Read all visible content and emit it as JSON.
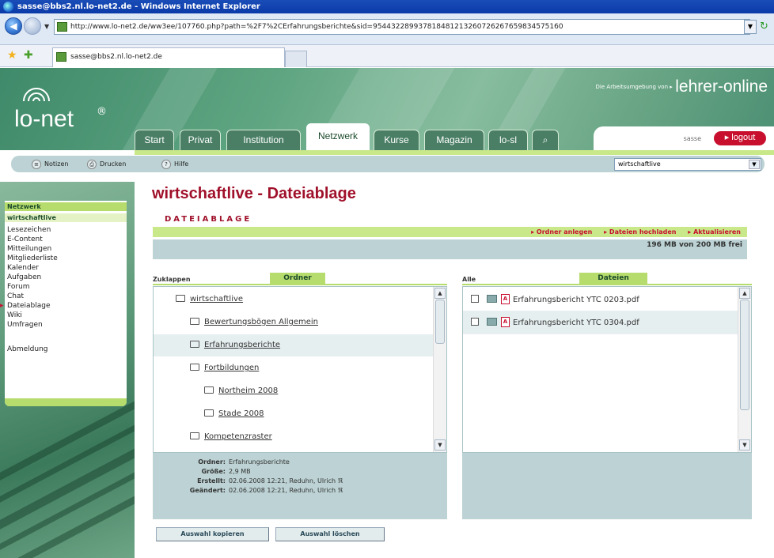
{
  "browser": {
    "title": "sasse@bbs2.nl.lo-net2.de - Windows Internet Explorer",
    "url": "http://www.lo-net2.de/ww3ee/107760.php?path=%2F7%2CErfahrungsberichte&sid=95443228993781848121326072626765983457516​0",
    "tab_title": "sasse@bbs2.nl.lo-net2.de"
  },
  "site": {
    "logo": "lo-net",
    "logo_reg": "®",
    "partner_small": "Die Arbeitsumgebung von ▸",
    "partner_big": "lehrer-online",
    "user": "sasse",
    "logout": "logout"
  },
  "tabs": [
    {
      "label": "Start"
    },
    {
      "label": "Privat"
    },
    {
      "label": "Institution"
    },
    {
      "label": "Netzwerk"
    },
    {
      "label": "Kurse"
    },
    {
      "label": "Magazin"
    },
    {
      "label": "lo-sl"
    },
    {
      "label": "⌕"
    }
  ],
  "toolbar": {
    "notes": "Notizen",
    "print": "Drucken",
    "help": "Hilfe",
    "select_value": "wirtschaftlive"
  },
  "sidebar": {
    "head": "Netzwerk",
    "sub": "wirtschaftlive",
    "items": [
      {
        "label": "Lesezeichen"
      },
      {
        "label": "E-Content"
      },
      {
        "label": "Mitteilungen"
      },
      {
        "label": "Mitgliederliste"
      },
      {
        "label": "Kalender"
      },
      {
        "label": "Aufgaben"
      },
      {
        "label": "Forum"
      },
      {
        "label": "Chat"
      },
      {
        "label": "Dateiablage"
      },
      {
        "label": "Wiki"
      },
      {
        "label": "Umfragen"
      },
      {
        "label": "Abmeldung"
      }
    ]
  },
  "main": {
    "title": "wirtschaftlive - Dateiablage",
    "subheading": "DATEIABLAGE",
    "actions": [
      "▸ Ordner anlegen",
      "▸ Dateien hochladen",
      "▸ Aktualisieren"
    ],
    "quota": "196 MB von 200 MB frei",
    "collapse": "Zuklappen",
    "folders_tag": "Ordner",
    "all": "Alle",
    "files_tag": "Dateien",
    "folders": [
      {
        "name": "wirtschaftlive"
      },
      {
        "name": "Bewertungsbögen Allgemein"
      },
      {
        "name": "Erfahrungsberichte"
      },
      {
        "name": "Fortbildungen"
      },
      {
        "name": "Northeim 2008"
      },
      {
        "name": "Stade 2008"
      },
      {
        "name": "Kompetenzraster"
      }
    ],
    "files": [
      {
        "name": "Erfahrungsbericht YTC 0203.pdf"
      },
      {
        "name": "Erfahrungsbericht YTC 0304.pdf"
      }
    ],
    "info": {
      "folder_k": "Ordner:",
      "folder_v": "Erfahrungsberichte",
      "size_k": "Größe:",
      "size_v": "2,9 MB",
      "created_k": "Erstellt:",
      "created_v": "02.06.2008 12:21, Reduhn, Ulrich",
      "changed_k": "Geändert:",
      "changed_v": "02.06.2008 12:21, Reduhn, Ulrich"
    },
    "copy_btn": "Auswahl kopieren",
    "delete_btn": "Auswahl löschen"
  }
}
